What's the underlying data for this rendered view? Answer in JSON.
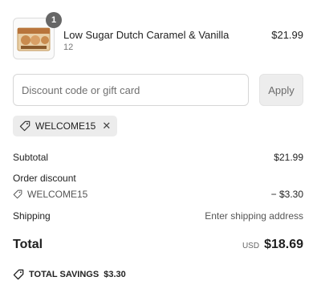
{
  "line_item": {
    "quantity_badge": "1",
    "title": "Low Sugar Dutch Caramel & Vanilla",
    "variant": "12",
    "price": "$21.99",
    "thumbnail_icon": "product-box-image"
  },
  "discount": {
    "placeholder": "Discount code or gift card",
    "apply_label": "Apply",
    "applied_code": "WELCOME15"
  },
  "summary": {
    "subtotal_label": "Subtotal",
    "subtotal_value": "$21.99",
    "order_discount_label": "Order discount",
    "discount_code": "WELCOME15",
    "discount_value": "− $3.30",
    "shipping_label": "Shipping",
    "shipping_value": "Enter shipping address"
  },
  "total": {
    "label": "Total",
    "currency": "USD",
    "value": "$18.69"
  },
  "savings": {
    "label": "TOTAL SAVINGS",
    "value": "$3.30"
  },
  "colors": {
    "badge": "#666666",
    "chip_bg": "#ececec",
    "apply_bg": "#ededed"
  }
}
